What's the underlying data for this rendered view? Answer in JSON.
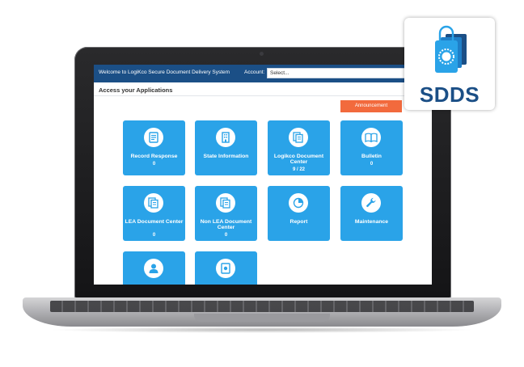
{
  "header": {
    "welcome": "Welcome to LogiKco Secure Document Delivery System",
    "account_label": "Account:",
    "account_placeholder": "Select..."
  },
  "main": {
    "section_title": "Access your Applications",
    "announcement_label": "Announcement",
    "tiles": [
      {
        "label": "Record Response",
        "count": "0",
        "icon": "document-icon"
      },
      {
        "label": "State Information",
        "count": "",
        "icon": "building-icon"
      },
      {
        "label": "Logikco Document Center",
        "count": "9 / 22",
        "icon": "documents-icon"
      },
      {
        "label": "Bulletin",
        "count": "0",
        "icon": "book-icon"
      },
      {
        "label": "LEA Document Center",
        "count": "0",
        "icon": "documents-icon"
      },
      {
        "label": "Non LEA Document Center",
        "count": "0",
        "icon": "documents-icon"
      },
      {
        "label": "Report",
        "count": "",
        "icon": "pie-chart-icon"
      },
      {
        "label": "Maintenance",
        "count": "",
        "icon": "wrench-icon"
      },
      {
        "label": "",
        "count": "",
        "icon": "user-icon"
      },
      {
        "label": "",
        "count": "",
        "icon": "secure-document-icon"
      }
    ]
  },
  "badge": {
    "text": "SDDS",
    "icon": "sdds-documents-icon"
  },
  "colors": {
    "header_bg": "#1b4f86",
    "tile_bg": "#2aa3e8",
    "announcement_bg": "#f26a3d",
    "badge_text": "#1b4f86"
  }
}
